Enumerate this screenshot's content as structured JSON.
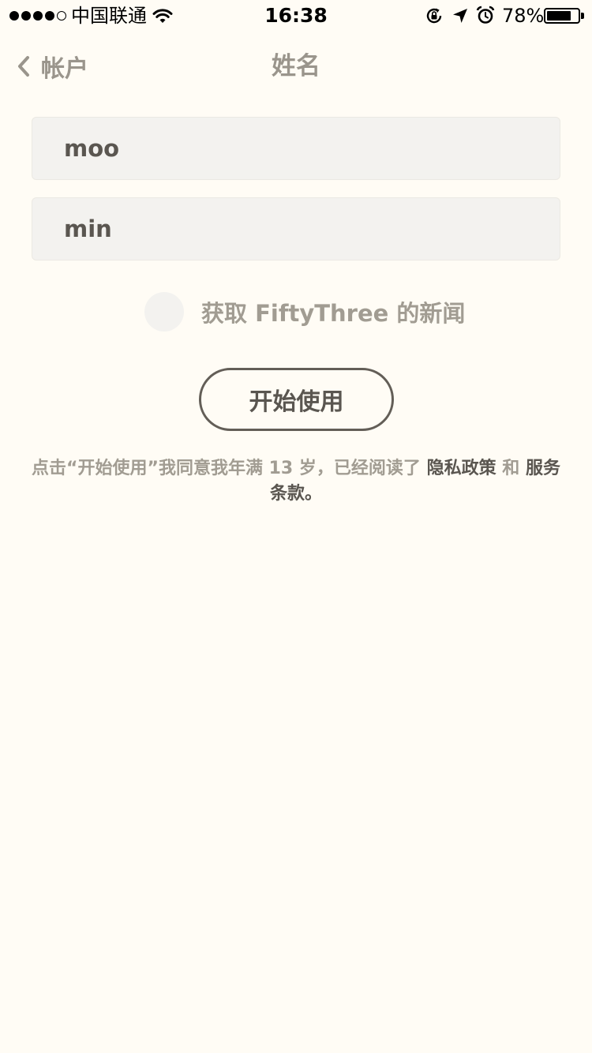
{
  "status_bar": {
    "carrier": "中国联通",
    "time": "16:38",
    "battery_percent": "78%",
    "battery_level": 0.78,
    "signal_bars_filled": 4,
    "signal_bars_total": 5
  },
  "nav": {
    "back_label": "帐户",
    "title": "姓名"
  },
  "form": {
    "first_name": "moo",
    "last_name": "min"
  },
  "newsletter": {
    "label": "获取 FiftyThree 的新闻",
    "checked": false
  },
  "start_button": {
    "label": "开始使用"
  },
  "terms": {
    "prefix": "点击“开始使用”我同意我年满 13 岁，已经阅读了",
    "privacy_link": "隐私政策",
    "conjunction": "和",
    "terms_link": "服务条款",
    "suffix": "。"
  },
  "colors": {
    "background": "#fffcf5",
    "field_background": "#f3f2ef",
    "muted_text": "#a19c92",
    "dark_text": "#5a5650",
    "button_border": "#635e57"
  },
  "icons": {
    "back": "chevron-left-icon",
    "wifi": "wifi-icon",
    "rotation_lock": "rotation-lock-icon",
    "location": "location-arrow-icon",
    "alarm": "alarm-clock-icon",
    "battery": "battery-icon"
  }
}
